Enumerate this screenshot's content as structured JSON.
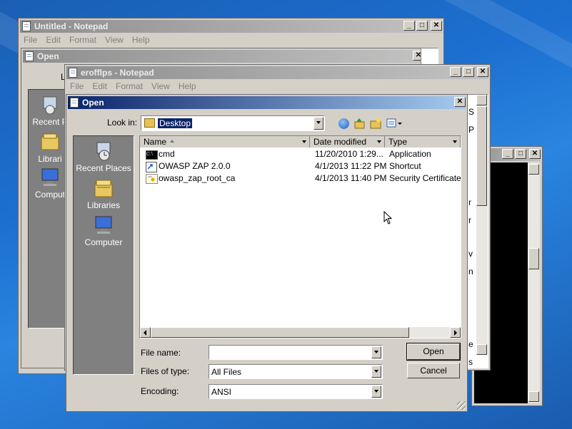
{
  "bg_notepad": {
    "title": "Untitled - Notepad",
    "menus": [
      "File",
      "Edit",
      "Format",
      "View",
      "Help"
    ],
    "open_dialog_title": "Open",
    "places": [
      "Recent P",
      "Librari",
      "Comput"
    ],
    "l_fragment": "L"
  },
  "console": {
    "title": ""
  },
  "fg_notepad": {
    "title": "erofflps - Notepad",
    "menus": [
      "File",
      "Edit",
      "Format",
      "View",
      "Help"
    ],
    "right_text_fragments": [
      "S",
      "P",
      "r",
      "r",
      "v",
      "n",
      "e",
      "s"
    ]
  },
  "open_dialog": {
    "title": "Open",
    "look_in_label": "Look in:",
    "look_in_value": "Desktop",
    "places": [
      {
        "label": "Recent Places",
        "icon": "recent-places-icon"
      },
      {
        "label": "Libraries",
        "icon": "libraries-icon"
      },
      {
        "label": "Computer",
        "icon": "computer-icon"
      }
    ],
    "columns": [
      "Name",
      "Date modified",
      "Type"
    ],
    "files": [
      {
        "name": "cmd",
        "date": "11/20/2010 1:29...",
        "type": "Application",
        "icon": "cmd-icon"
      },
      {
        "name": "OWASP ZAP 2.0.0",
        "date": "4/1/2013 11:22 PM",
        "type": "Shortcut",
        "icon": "shortcut-icon"
      },
      {
        "name": "owasp_zap_root_ca",
        "date": "4/1/2013 11:40 PM",
        "type": "Security Certificate",
        "icon": "certificate-icon"
      }
    ],
    "file_name_label": "File name:",
    "file_name_value": "",
    "files_of_type_label": "Files of type:",
    "files_of_type_value": "All Files",
    "encoding_label": "Encoding:",
    "encoding_value": "ANSI",
    "open_button": "Open",
    "cancel_button": "Cancel"
  }
}
